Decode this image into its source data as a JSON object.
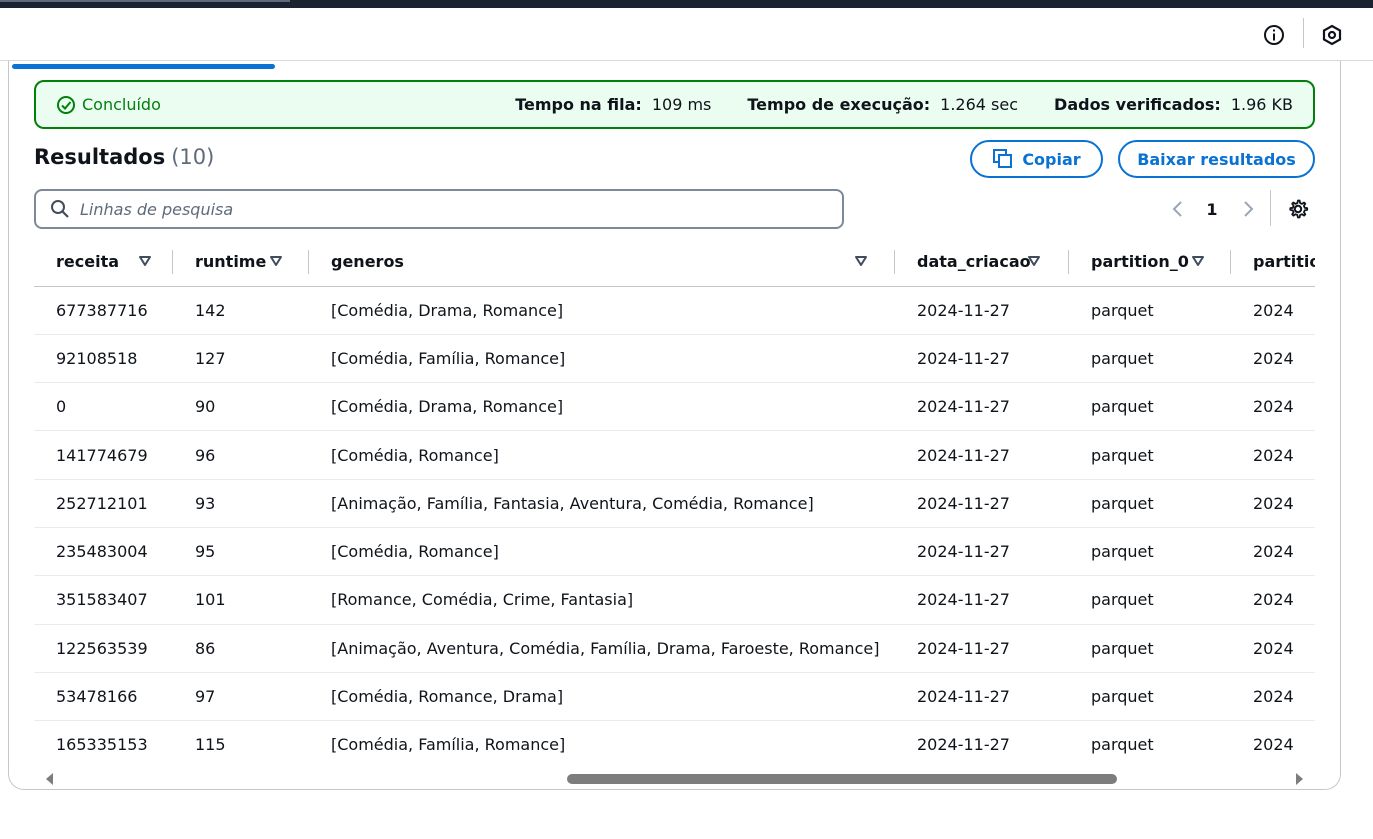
{
  "header": {
    "info_icon": "info-icon",
    "settings_icon": "hex-gear-icon"
  },
  "status": {
    "label": "Concluído",
    "queue_time_label": "Tempo na fila:",
    "queue_time_value": "109 ms",
    "exec_time_label": "Tempo de execução:",
    "exec_time_value": "1.264 sec",
    "data_scanned_label": "Dados verificados:",
    "data_scanned_value": "1.96 KB",
    "color": "#037f0c",
    "background": "#eafdf0"
  },
  "results": {
    "title": "Resultados",
    "count": "(10)",
    "copy_label": "Copiar",
    "download_label": "Baixar resultados",
    "search_placeholder": "Linhas de pesquisa",
    "page": "1"
  },
  "table": {
    "columns": [
      "receita",
      "runtime",
      "generos",
      "data_criacao",
      "partition_0",
      "partitio"
    ],
    "rows": [
      [
        "677387716",
        "142",
        "[Comédia, Drama, Romance]",
        "2024-11-27",
        "parquet",
        "2024"
      ],
      [
        "92108518",
        "127",
        "[Comédia, Família, Romance]",
        "2024-11-27",
        "parquet",
        "2024"
      ],
      [
        "0",
        "90",
        "[Comédia, Drama, Romance]",
        "2024-11-27",
        "parquet",
        "2024"
      ],
      [
        "141774679",
        "96",
        "[Comédia, Romance]",
        "2024-11-27",
        "parquet",
        "2024"
      ],
      [
        "252712101",
        "93",
        "[Animação, Família, Fantasia, Aventura, Comédia, Romance]",
        "2024-11-27",
        "parquet",
        "2024"
      ],
      [
        "235483004",
        "95",
        "[Comédia, Romance]",
        "2024-11-27",
        "parquet",
        "2024"
      ],
      [
        "351583407",
        "101",
        "[Romance, Comédia, Crime, Fantasia]",
        "2024-11-27",
        "parquet",
        "2024"
      ],
      [
        "122563539",
        "86",
        "[Animação, Aventura, Comédia, Família, Drama, Faroeste, Romance]",
        "2024-11-27",
        "parquet",
        "2024"
      ],
      [
        "53478166",
        "97",
        "[Comédia, Romance, Drama]",
        "2024-11-27",
        "parquet",
        "2024"
      ],
      [
        "165335153",
        "115",
        "[Comédia, Família, Romance]",
        "2024-11-27",
        "parquet",
        "2024"
      ]
    ]
  },
  "colors": {
    "accent": "#0972d3",
    "success": "#037f0c"
  }
}
